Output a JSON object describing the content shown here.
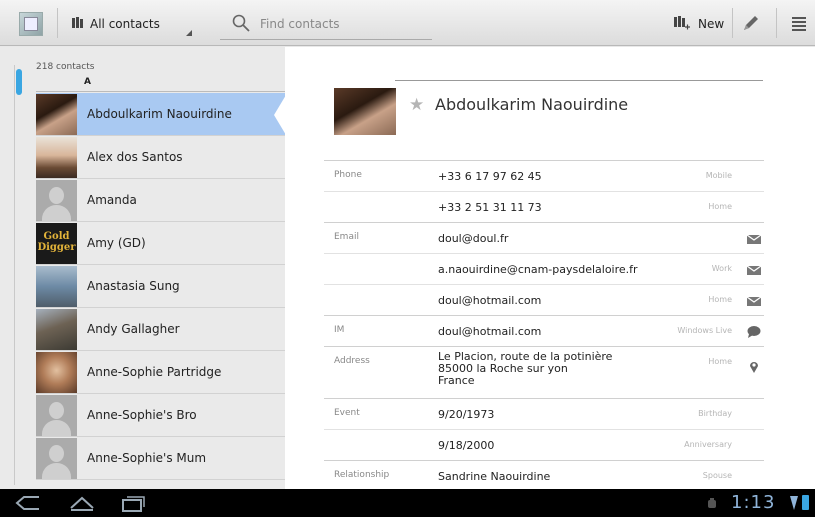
{
  "toolbar": {
    "filter_label": "All contacts",
    "search_placeholder": "Find contacts",
    "new_label": "New",
    "icons": [
      "app-icon",
      "library-icon",
      "search-icon",
      "add-contact-icon",
      "edit-icon",
      "menu-icon"
    ]
  },
  "list": {
    "count_label": "218 contacts",
    "section_letter": "A",
    "contacts": [
      {
        "name": "Abdoulkarim Naouirdine",
        "avatar": "photo",
        "selected": true
      },
      {
        "name": "Alex dos Santos",
        "avatar": "photo"
      },
      {
        "name": "Amanda",
        "avatar": "placeholder"
      },
      {
        "name": "Amy (GD)",
        "avatar": "gold-digger",
        "avatar_text": "Gold Digger"
      },
      {
        "name": "Anastasia Sung",
        "avatar": "photo"
      },
      {
        "name": "Andy Gallagher",
        "avatar": "photo"
      },
      {
        "name": "Anne-Sophie Partridge",
        "avatar": "photo"
      },
      {
        "name": "Anne-Sophie's Bro",
        "avatar": "placeholder"
      },
      {
        "name": "Anne-Sophie's Mum",
        "avatar": "placeholder"
      }
    ]
  },
  "detail": {
    "name": "Abdoulkarim Naouirdine",
    "starred": false,
    "fields": [
      {
        "category": "Phone",
        "value": "+33 6 17 97 62 45",
        "type": "Mobile",
        "icon": ""
      },
      {
        "category": "",
        "value": "+33 2 51 31 11 73",
        "type": "Home",
        "icon": ""
      },
      {
        "category": "Email",
        "value": "doul@doul.fr",
        "type": "",
        "icon": "email-icon"
      },
      {
        "category": "",
        "value": "a.naouirdine@cnam-paysdelaloire.fr",
        "type": "Work",
        "icon": "email-icon"
      },
      {
        "category": "",
        "value": "doul@hotmail.com",
        "type": "Home",
        "icon": "email-icon"
      },
      {
        "category": "IM",
        "value": "doul@hotmail.com",
        "type": "Windows Live",
        "icon": "chat-icon"
      },
      {
        "category": "Address",
        "value_lines": [
          "Le Placion, route de la potinière",
          "85000 la Roche sur yon",
          "France"
        ],
        "type": "Home",
        "icon": "map-pin-icon"
      },
      {
        "category": "Event",
        "value": "9/20/1973",
        "type": "Birthday",
        "icon": ""
      },
      {
        "category": "",
        "value": "9/18/2000",
        "type": "Anniversary",
        "icon": ""
      },
      {
        "category": "Relationship",
        "value": "Sandrine Naouirdine",
        "type": "Spouse",
        "icon": ""
      }
    ]
  },
  "system_bar": {
    "time": "1:13",
    "icons": [
      "back-icon",
      "home-icon",
      "recent-apps-icon",
      "notification-icon",
      "signal-icon",
      "battery-icon"
    ]
  },
  "colors": {
    "selected_row": "#a9c9f2",
    "accent_blue": "#3aa6e2",
    "clock": "#8fb4d9"
  }
}
